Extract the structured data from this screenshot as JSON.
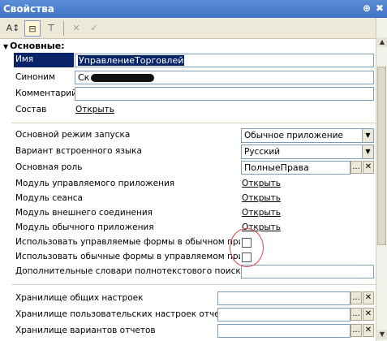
{
  "window": {
    "title": "Свойства",
    "pin_glyph": "⊕",
    "close_glyph": "✖"
  },
  "toolbar": {
    "sort_glyph": "A↕",
    "categorize_glyph": "⊟",
    "filter_glyph": "⊤",
    "cancel_glyph": "✕",
    "apply_glyph": "✓"
  },
  "group": {
    "title": "Основные:"
  },
  "properties": {
    "name": {
      "label": "Имя",
      "value": "УправлениеТорговлей"
    },
    "synonym": {
      "label": "Синоним",
      "value": "Ск"
    },
    "comment": {
      "label": "Комментарий",
      "value": ""
    },
    "composition": {
      "label": "Состав",
      "link": "Открыть"
    },
    "launch_mode": {
      "label": "Основной режим запуска",
      "value": "Обычное приложение"
    },
    "language": {
      "label": "Вариант встроенного языка",
      "value": "Русский"
    },
    "main_role": {
      "label": "Основная роль",
      "value": "ПолныеПрава"
    },
    "managed_app_module": {
      "label": "Модуль управляемого приложения",
      "link": "Открыть"
    },
    "session_module": {
      "label": "Модуль сеанса",
      "link": "Открыть"
    },
    "external_conn_module": {
      "label": "Модуль внешнего соединения",
      "link": "Открыть"
    },
    "ordinary_app_module": {
      "label": "Модуль обычного приложения",
      "link": "Открыть"
    },
    "use_managed_forms": {
      "label": "Использовать управляемые формы в обычном прило",
      "checked": false
    },
    "use_ordinary_forms": {
      "label": "Использовать обычные формы в управляемом прило",
      "checked": false
    },
    "fulltext_dicts": {
      "label": "Дополнительные словари полнотекстового поиска",
      "value": ""
    },
    "common_settings_storage": {
      "label": "Хранилище общих настроек",
      "value": ""
    },
    "report_user_settings_storage": {
      "label": "Хранилище пользовательских настроек отчетов",
      "value": ""
    },
    "report_variants_storage": {
      "label": "Хранилище вариантов отчетов",
      "value": ""
    }
  },
  "buttons": {
    "dropdown_glyph": "▼",
    "select_glyph": "...",
    "clear_glyph": "✕"
  },
  "scroll": {
    "up_glyph": "▲",
    "down_glyph": "▼"
  },
  "colors": {
    "title_bar": "#3f73c4",
    "selection": "#0a246a",
    "annotation_circle": "#e04848"
  }
}
